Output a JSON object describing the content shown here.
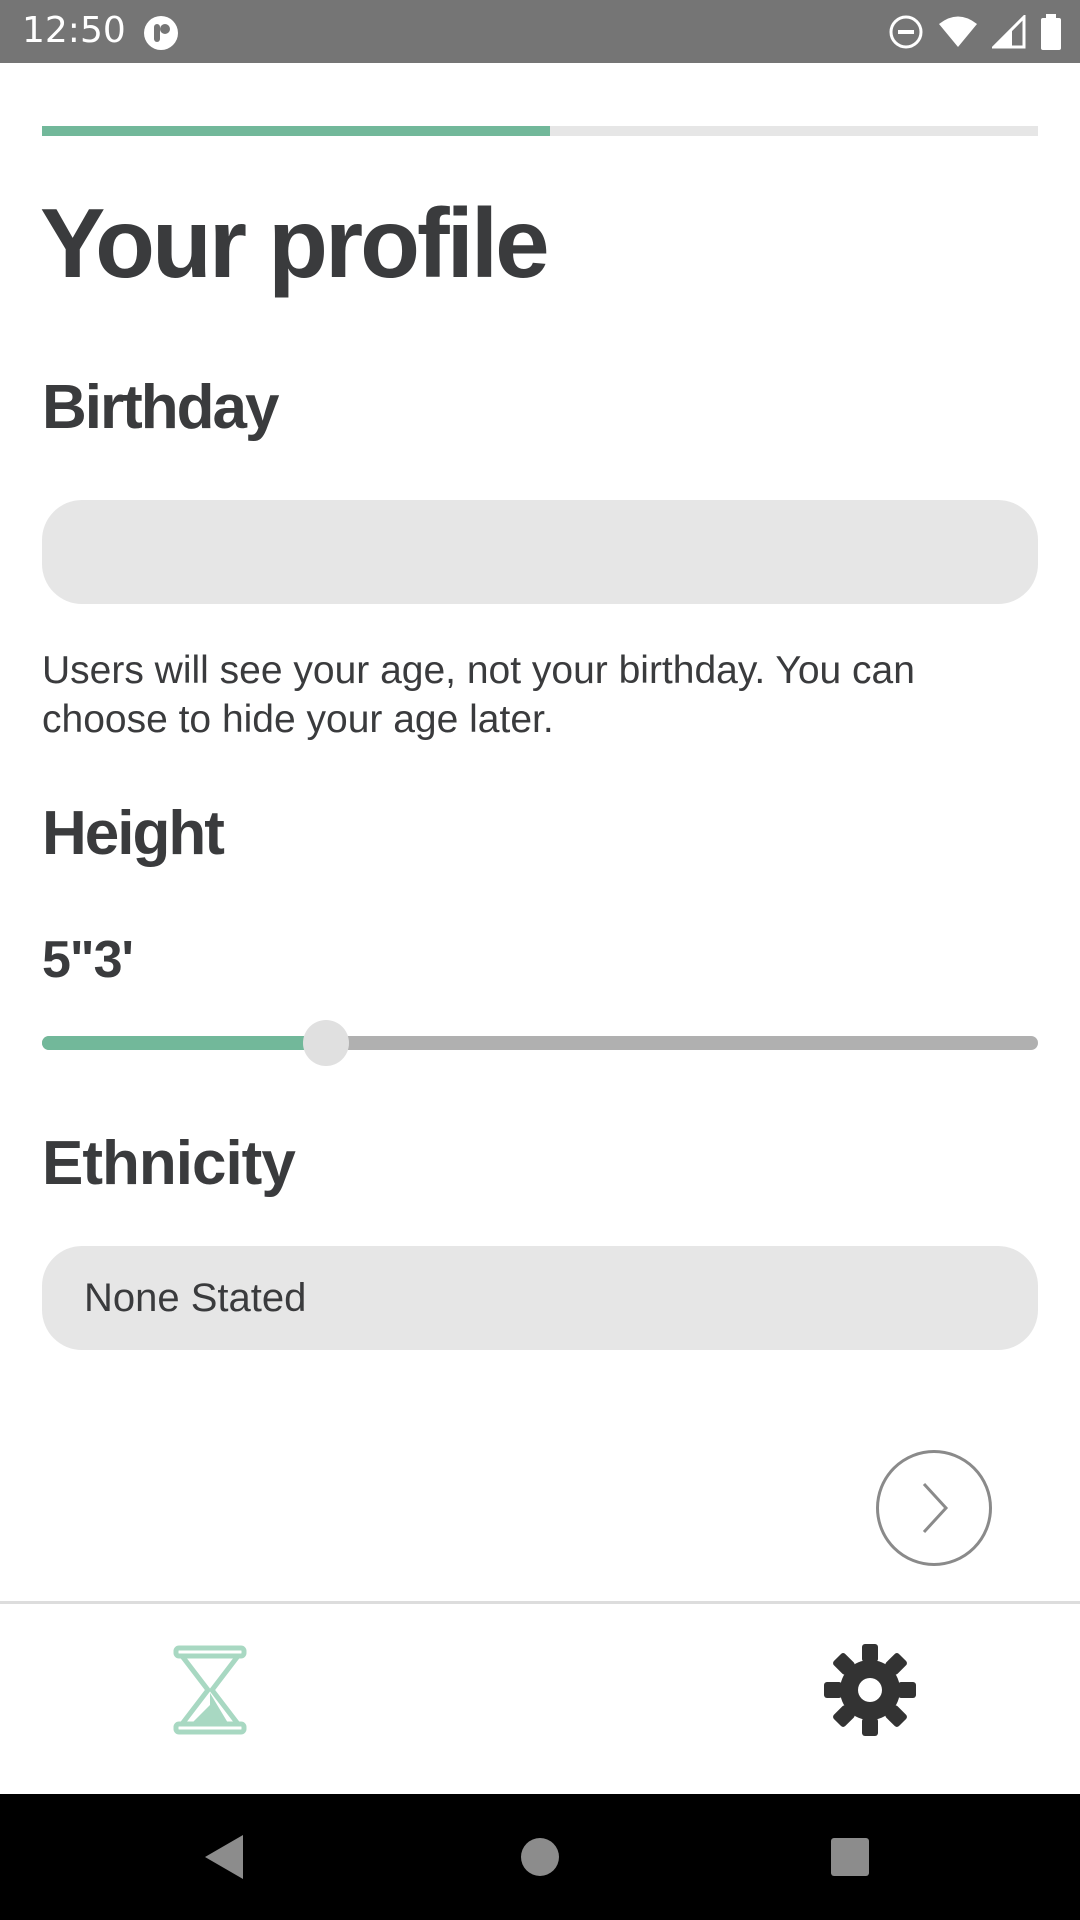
{
  "status_bar": {
    "time": "12:50",
    "icons": [
      "app-notification-icon",
      "do-not-disturb-icon",
      "wifi-icon",
      "cellular-signal-icon",
      "battery-icon"
    ]
  },
  "progress": {
    "fraction": 0.51,
    "fill_color": "#72b89a",
    "track_color": "#e6e6e6"
  },
  "page": {
    "title": "Your profile"
  },
  "birthday": {
    "label": "Birthday",
    "value": "",
    "helper": "Users will see your age, not your birthday. You can choose to hide your age later."
  },
  "height": {
    "label": "Height",
    "value": "5\"3'",
    "slider_fraction": 0.285
  },
  "ethnicity": {
    "label": "Ethnicity",
    "value": "None Stated"
  },
  "next_button": {
    "icon": "chevron-right-icon"
  },
  "bottom_nav": {
    "items": [
      {
        "icon": "hourglass-icon",
        "active": true,
        "color": "#a8d8c2"
      },
      {
        "icon": "gear-icon",
        "active": false,
        "color": "#333333"
      }
    ]
  },
  "system_nav": {
    "items": [
      "back-icon",
      "home-icon",
      "recents-icon"
    ]
  },
  "colors": {
    "accent": "#72b89a",
    "text": "#3a3b3d",
    "field_bg": "#e6e6e6"
  }
}
